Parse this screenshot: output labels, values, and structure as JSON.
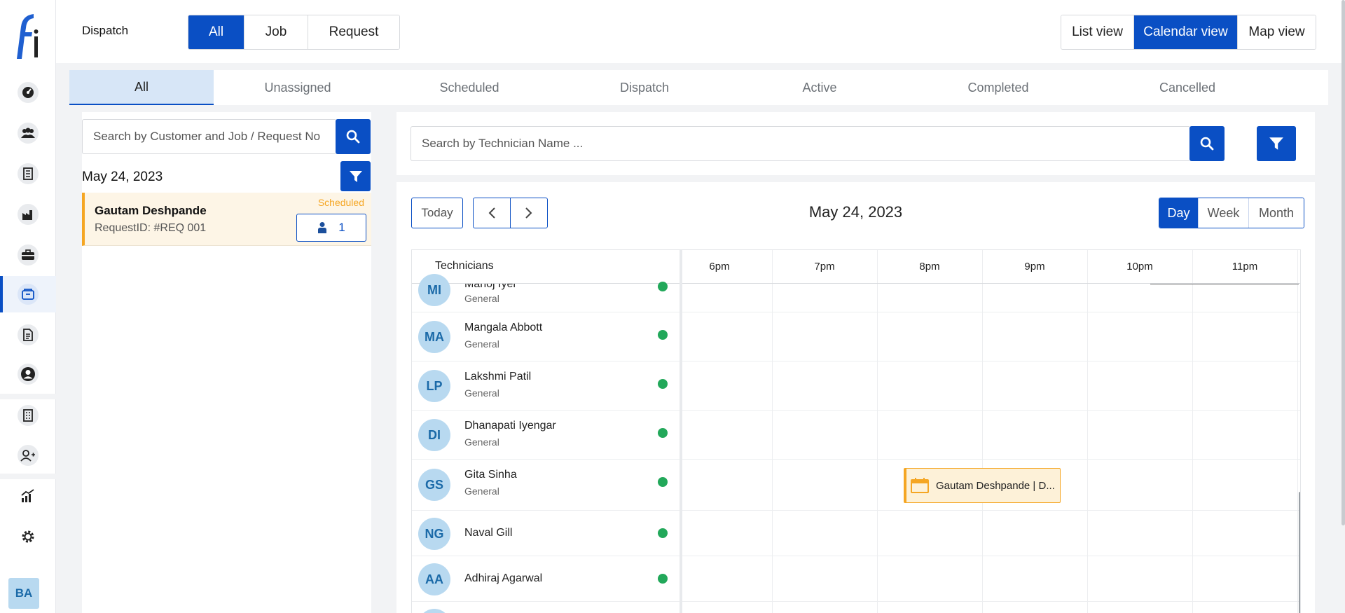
{
  "header": {
    "title": "Dispatch",
    "type_tabs": [
      "All",
      "Job",
      "Request"
    ],
    "view_tabs": [
      "List view",
      "Calendar view",
      "Map view"
    ]
  },
  "status_tabs": [
    "All",
    "Unassigned",
    "Scheduled",
    "Dispatch",
    "Active",
    "Completed",
    "Cancelled"
  ],
  "left": {
    "search_placeholder": "Search by Customer and Job / Request No",
    "date": "May 24, 2023",
    "request": {
      "customer": "Gautam Deshpande",
      "request_id": "RequestID: #REQ 001",
      "status": "Scheduled",
      "assigned_count": "1"
    }
  },
  "calendar": {
    "tech_search_placeholder": "Search by Technician Name ...",
    "today_label": "Today",
    "date": "May 24, 2023",
    "views": [
      "Day",
      "Week",
      "Month"
    ],
    "technicians_header": "Technicians",
    "hours": [
      "6pm",
      "7pm",
      "8pm",
      "9pm",
      "10pm",
      "11pm"
    ],
    "technicians": [
      {
        "initials": "MI",
        "name": "Manoj Iyer",
        "role": "General"
      },
      {
        "initials": "MA",
        "name": "Mangala Abbott",
        "role": "General"
      },
      {
        "initials": "LP",
        "name": "Lakshmi Patil",
        "role": "General"
      },
      {
        "initials": "DI",
        "name": "Dhanapati Iyengar",
        "role": "General"
      },
      {
        "initials": "GS",
        "name": "Gita Sinha",
        "role": "General"
      },
      {
        "initials": "NG",
        "name": "Naval Gill",
        "role": ""
      },
      {
        "initials": "AA",
        "name": "Adhiraj Agarwal",
        "role": ""
      }
    ],
    "event_label": "Gautam Deshpande | D..."
  },
  "user": {
    "initials": "BA"
  },
  "colors": {
    "primary": "#0a4fc4",
    "scheduled": "#f5a623",
    "online": "#22a85a",
    "avatar_bg": "#b8d9f0"
  }
}
